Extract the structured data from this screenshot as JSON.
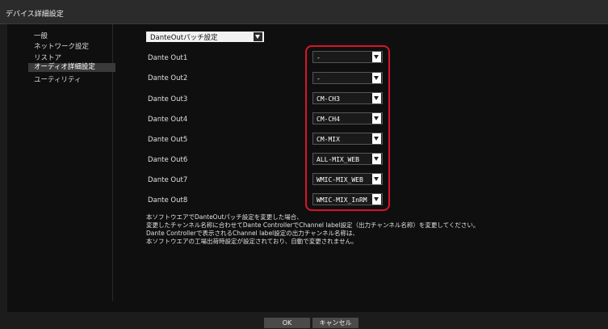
{
  "window": {
    "title": "デバイス詳細設定"
  },
  "sidebar": {
    "items": [
      {
        "label": "一般"
      },
      {
        "label": "ネットワーク設定"
      },
      {
        "label": "リストア"
      },
      {
        "label": "オーディオ詳細設定",
        "selected": true
      },
      {
        "label": "ユーティリティ"
      }
    ]
  },
  "section_select": {
    "value": "DanteOutパッチ設定"
  },
  "outputs": [
    {
      "label": "Dante Out1",
      "value": "-"
    },
    {
      "label": "Dante Out2",
      "value": "-"
    },
    {
      "label": "Dante Out3",
      "value": "CM-CH3"
    },
    {
      "label": "Dante Out4",
      "value": "CM-CH4"
    },
    {
      "label": "Dante Out5",
      "value": "CM-MIX"
    },
    {
      "label": "Dante Out6",
      "value": "ALL-MIX_WEB"
    },
    {
      "label": "Dante Out7",
      "value": "WMIC-MIX_WEB"
    },
    {
      "label": "Dante Out8",
      "value": "WMIC-MIX_InRM"
    }
  ],
  "notes": [
    "本ソフトウエアでDanteOutパッチ設定を変更した場合、",
    "変更したチャンネル名称に合わせてDante ControllerでChannel label設定（出力チャンネル名称）を変更してください。",
    "Dante Controllerで表示されるChannel label設定の出力チャンネル名称は、",
    "本ソフトウエアの工場出荷時設定が設定されており、自動で変更されません。"
  ],
  "buttons": {
    "ok": "OK",
    "cancel": "キャンセル"
  },
  "colors": {
    "highlight": "#d9142c"
  }
}
